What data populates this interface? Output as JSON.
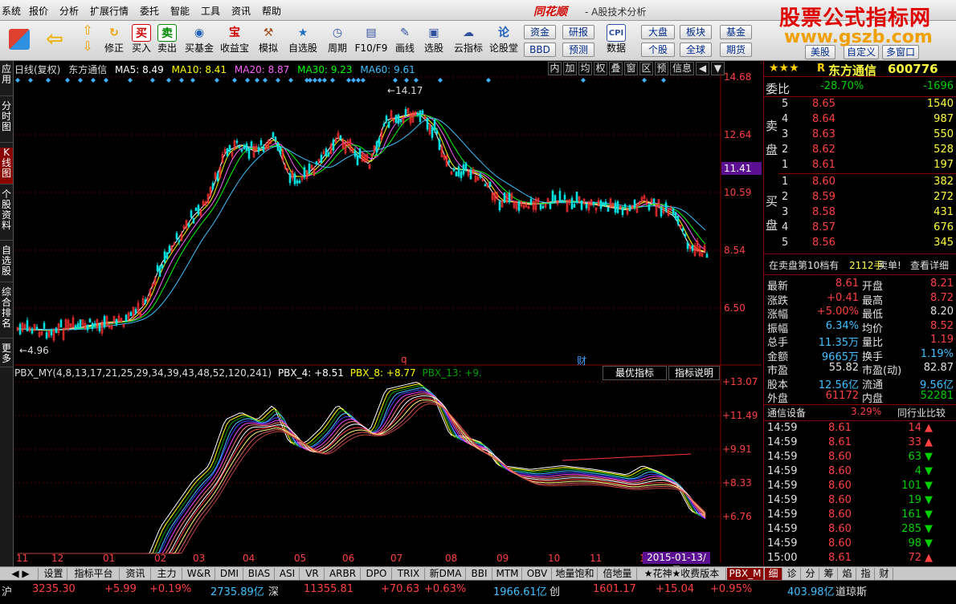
{
  "menu": [
    "系统",
    "报价",
    "分析",
    "扩展行情",
    "委托",
    "智能",
    "工具",
    "资讯",
    "帮助"
  ],
  "brand": "同花顺",
  "subtitle": "- A股技术分析",
  "watermark": {
    "line1": "股票公式指标网",
    "line2": "www.gszb.com"
  },
  "toolbar": {
    "buttons": [
      {
        "label": "",
        "icon": "grid-icon",
        "color": "#e05030"
      },
      {
        "label": "",
        "icon": "back-arrow-icon",
        "color": "#f0c000"
      },
      {
        "label": "",
        "icon": "up-arrow-icon",
        "color": "#f0c000"
      },
      {
        "label": "修正",
        "icon": "refresh-icon",
        "color": "#f0a000",
        "glyph": "↻"
      },
      {
        "label": "买入",
        "icon": "buy-icon",
        "color": "#d00000",
        "glyph": "买"
      },
      {
        "label": "卖出",
        "icon": "sell-icon",
        "color": "#008800",
        "glyph": "卖"
      },
      {
        "label": "买基金",
        "icon": "fund-icon",
        "color": "#2060c0",
        "glyph": "◉"
      },
      {
        "label": "收益宝",
        "icon": "bonus-icon",
        "color": "#d00000",
        "glyph": "宝"
      },
      {
        "label": "模拟",
        "icon": "hammer-icon",
        "color": "#a05020",
        "glyph": "⚒"
      },
      {
        "label": "自选股",
        "icon": "star-icon",
        "color": "#2070c0",
        "glyph": "★"
      },
      {
        "label": "周期",
        "icon": "clock-icon",
        "color": "#3050a0",
        "glyph": "◷"
      },
      {
        "label": "F10/F9",
        "icon": "doc-icon",
        "color": "#3050a0",
        "glyph": "▤"
      },
      {
        "label": "画线",
        "icon": "pen-icon",
        "color": "#3050a0",
        "glyph": "✎"
      },
      {
        "label": "选股",
        "icon": "filter-icon",
        "color": "#3050a0",
        "glyph": "▣"
      },
      {
        "label": "云指标",
        "icon": "cloud-icon",
        "color": "#3050a0",
        "glyph": "☁"
      },
      {
        "label": "论股堂",
        "icon": "forum-icon",
        "color": "#2060c0",
        "glyph": "论"
      },
      {
        "label": "数据",
        "icon": "cpi-icon",
        "color": "#3050a0",
        "glyph": "CPI"
      }
    ],
    "small_buttons": [
      "资金",
      "研报",
      "大盘",
      "板块",
      "基金",
      "BBD",
      "预测",
      "个股",
      "全球",
      "期货",
      "美股",
      "自定义",
      "多窗口"
    ]
  },
  "left_tabs": [
    "应用",
    "分时图",
    "K线图",
    "个股资料",
    "自选股",
    "综合排名",
    "更多"
  ],
  "kline": {
    "title": "日线(复权)",
    "stock_name": "东方通信",
    "ma": [
      {
        "label": "MA5: 8.49",
        "color": "#ffffff"
      },
      {
        "label": "MA10: 8.41",
        "color": "#ffff00"
      },
      {
        "label": "MA20: 8.87",
        "color": "#ff60ff"
      },
      {
        "label": "MA30: 9.23",
        "color": "#00ff00"
      },
      {
        "label": "MA60: 9.61",
        "color": "#40c0ff"
      }
    ],
    "right_tabs": [
      "内",
      "加",
      "均",
      "权",
      "叠",
      "窗",
      "区",
      "预",
      "信息",
      "◀",
      "▼"
    ],
    "price_axis": [
      "14.68",
      "12.64",
      "10.59",
      "8.54",
      "6.50"
    ],
    "current_price_tag": "11.41",
    "high_label": "14.17",
    "low_label": "4.96",
    "markers": [
      "q",
      "财"
    ]
  },
  "indicator": {
    "title": "PBX_MY(4,8,13,17,21,25,29,34,39,43,48,52,120,241)",
    "values": [
      {
        "label": "PBX_4: +8.51",
        "color": "#ffffff"
      },
      {
        "label": "PBX_8: +8.77",
        "color": "#ffff00"
      },
      {
        "label": "PBX_13: +9.",
        "color": "#00a000"
      }
    ],
    "best_button": "最优指标",
    "explain_button": "指标说明",
    "axis": [
      "+13.07",
      "+11.49",
      "+9.91",
      "+8.33",
      "+6.76"
    ]
  },
  "x_axis": [
    "11",
    "12",
    "01",
    "02",
    "03",
    "04",
    "05",
    "06",
    "07",
    "08",
    "09",
    "10",
    "11",
    "1"
  ],
  "date_tag": "2015-01-13/二",
  "quote": {
    "name": "东方通信",
    "code": "600776",
    "stars": "★★★",
    "r": "R",
    "weibi_label": "委比",
    "weibi": "-28.70%",
    "weicha": "-1696",
    "sell_label": "卖盘",
    "buy_label": "买盘",
    "sell": [
      {
        "lvl": "5",
        "price": "8.65",
        "vol": "1540"
      },
      {
        "lvl": "4",
        "price": "8.64",
        "vol": "987"
      },
      {
        "lvl": "3",
        "price": "8.63",
        "vol": "550"
      },
      {
        "lvl": "2",
        "price": "8.62",
        "vol": "528"
      },
      {
        "lvl": "1",
        "price": "8.61",
        "vol": "197"
      }
    ],
    "buy": [
      {
        "lvl": "1",
        "price": "8.60",
        "vol": "382"
      },
      {
        "lvl": "2",
        "price": "8.59",
        "vol": "272"
      },
      {
        "lvl": "3",
        "price": "8.58",
        "vol": "431"
      },
      {
        "lvl": "4",
        "price": "8.57",
        "vol": "676"
      },
      {
        "lvl": "5",
        "price": "8.56",
        "vol": "345"
      }
    ],
    "notice": {
      "a": "在卖盘第10档有",
      "b": "2112手",
      "c": "卖单!",
      "d": "查看详细"
    },
    "stats": [
      {
        "l1": "最新",
        "v1": "8.61",
        "c1": "red",
        "l2": "开盘",
        "v2": "8.21",
        "c2": "red"
      },
      {
        "l1": "涨跌",
        "v1": "+0.41",
        "c1": "red",
        "l2": "最高",
        "v2": "8.72",
        "c2": "red"
      },
      {
        "l1": "涨幅",
        "v1": "+5.00%",
        "c1": "red",
        "l2": "最低",
        "v2": "8.20",
        "c2": "wht"
      },
      {
        "l1": "振幅",
        "v1": "6.34%",
        "c1": "cyn",
        "l2": "均价",
        "v2": "8.52",
        "c2": "red"
      },
      {
        "l1": "总手",
        "v1": "11.35万",
        "c1": "cyn",
        "l2": "量比",
        "v2": "1.19",
        "c2": "red"
      },
      {
        "l1": "金额",
        "v1": "9665万",
        "c1": "cyn",
        "l2": "换手",
        "v2": "1.19%",
        "c2": "cyn"
      },
      {
        "l1": "市盈",
        "v1": "55.82",
        "c1": "wht",
        "l2": "市盈(动)",
        "v2": "82.87",
        "c2": "wht"
      },
      {
        "l1": "股本",
        "v1": "12.56亿",
        "c1": "cyn",
        "l2": "流通",
        "v2": "9.56亿",
        "c2": "cyn"
      },
      {
        "l1": "外盘",
        "v1": "61172",
        "c1": "red",
        "l2": "内盘",
        "v2": "52281",
        "c2": "grn"
      }
    ],
    "sector": {
      "name": "通信设备",
      "change": "3.29%",
      "compare": "同行业比较"
    },
    "ticks": [
      {
        "t": "14:59",
        "p": "8.61",
        "v": "14",
        "d": "up"
      },
      {
        "t": "14:59",
        "p": "8.61",
        "v": "33",
        "d": "up"
      },
      {
        "t": "14:59",
        "p": "8.60",
        "v": "63",
        "d": "down"
      },
      {
        "t": "14:59",
        "p": "8.60",
        "v": "4",
        "d": "down"
      },
      {
        "t": "14:59",
        "p": "8.60",
        "v": "101",
        "d": "down"
      },
      {
        "t": "14:59",
        "p": "8.60",
        "v": "19",
        "d": "down"
      },
      {
        "t": "14:59",
        "p": "8.60",
        "v": "161",
        "d": "down"
      },
      {
        "t": "14:59",
        "p": "8.60",
        "v": "285",
        "d": "down"
      },
      {
        "t": "14:59",
        "p": "8.60",
        "v": "98",
        "d": "down"
      },
      {
        "t": "15:00",
        "p": "8.61",
        "v": "72",
        "d": "up"
      }
    ]
  },
  "bottom_tabs": [
    "设置",
    "指标平台",
    "资讯",
    "主力",
    "W&R",
    "DMI",
    "BIAS",
    "ASI",
    "VR",
    "ARBR",
    "DPO",
    "TRIX",
    "新DMA",
    "BBI",
    "MTM",
    "OBV",
    "地量饱和",
    "倍地量",
    "★花神★收费版本",
    "PBX_M",
    "细",
    "诊",
    "分",
    "筹",
    "焰",
    "指",
    "财"
  ],
  "status": {
    "sh_label": "沪",
    "sh_val": "3235.30",
    "sh_chg": "+5.99",
    "sh_pct": "+0.19%",
    "sh_amt": "2735.89亿",
    "sz_label": "深",
    "sz_val": "11355.81",
    "sz_chg": "+70.63",
    "sz_pct": "+0.63%",
    "sz_amt": "1966.61亿",
    "cy_label": "创",
    "cy_val": "1601.17",
    "cy_chg": "+15.04",
    "cy_pct": "+0.95%",
    "dj_amt": "403.98亿",
    "dj_label": "道琼斯"
  }
}
